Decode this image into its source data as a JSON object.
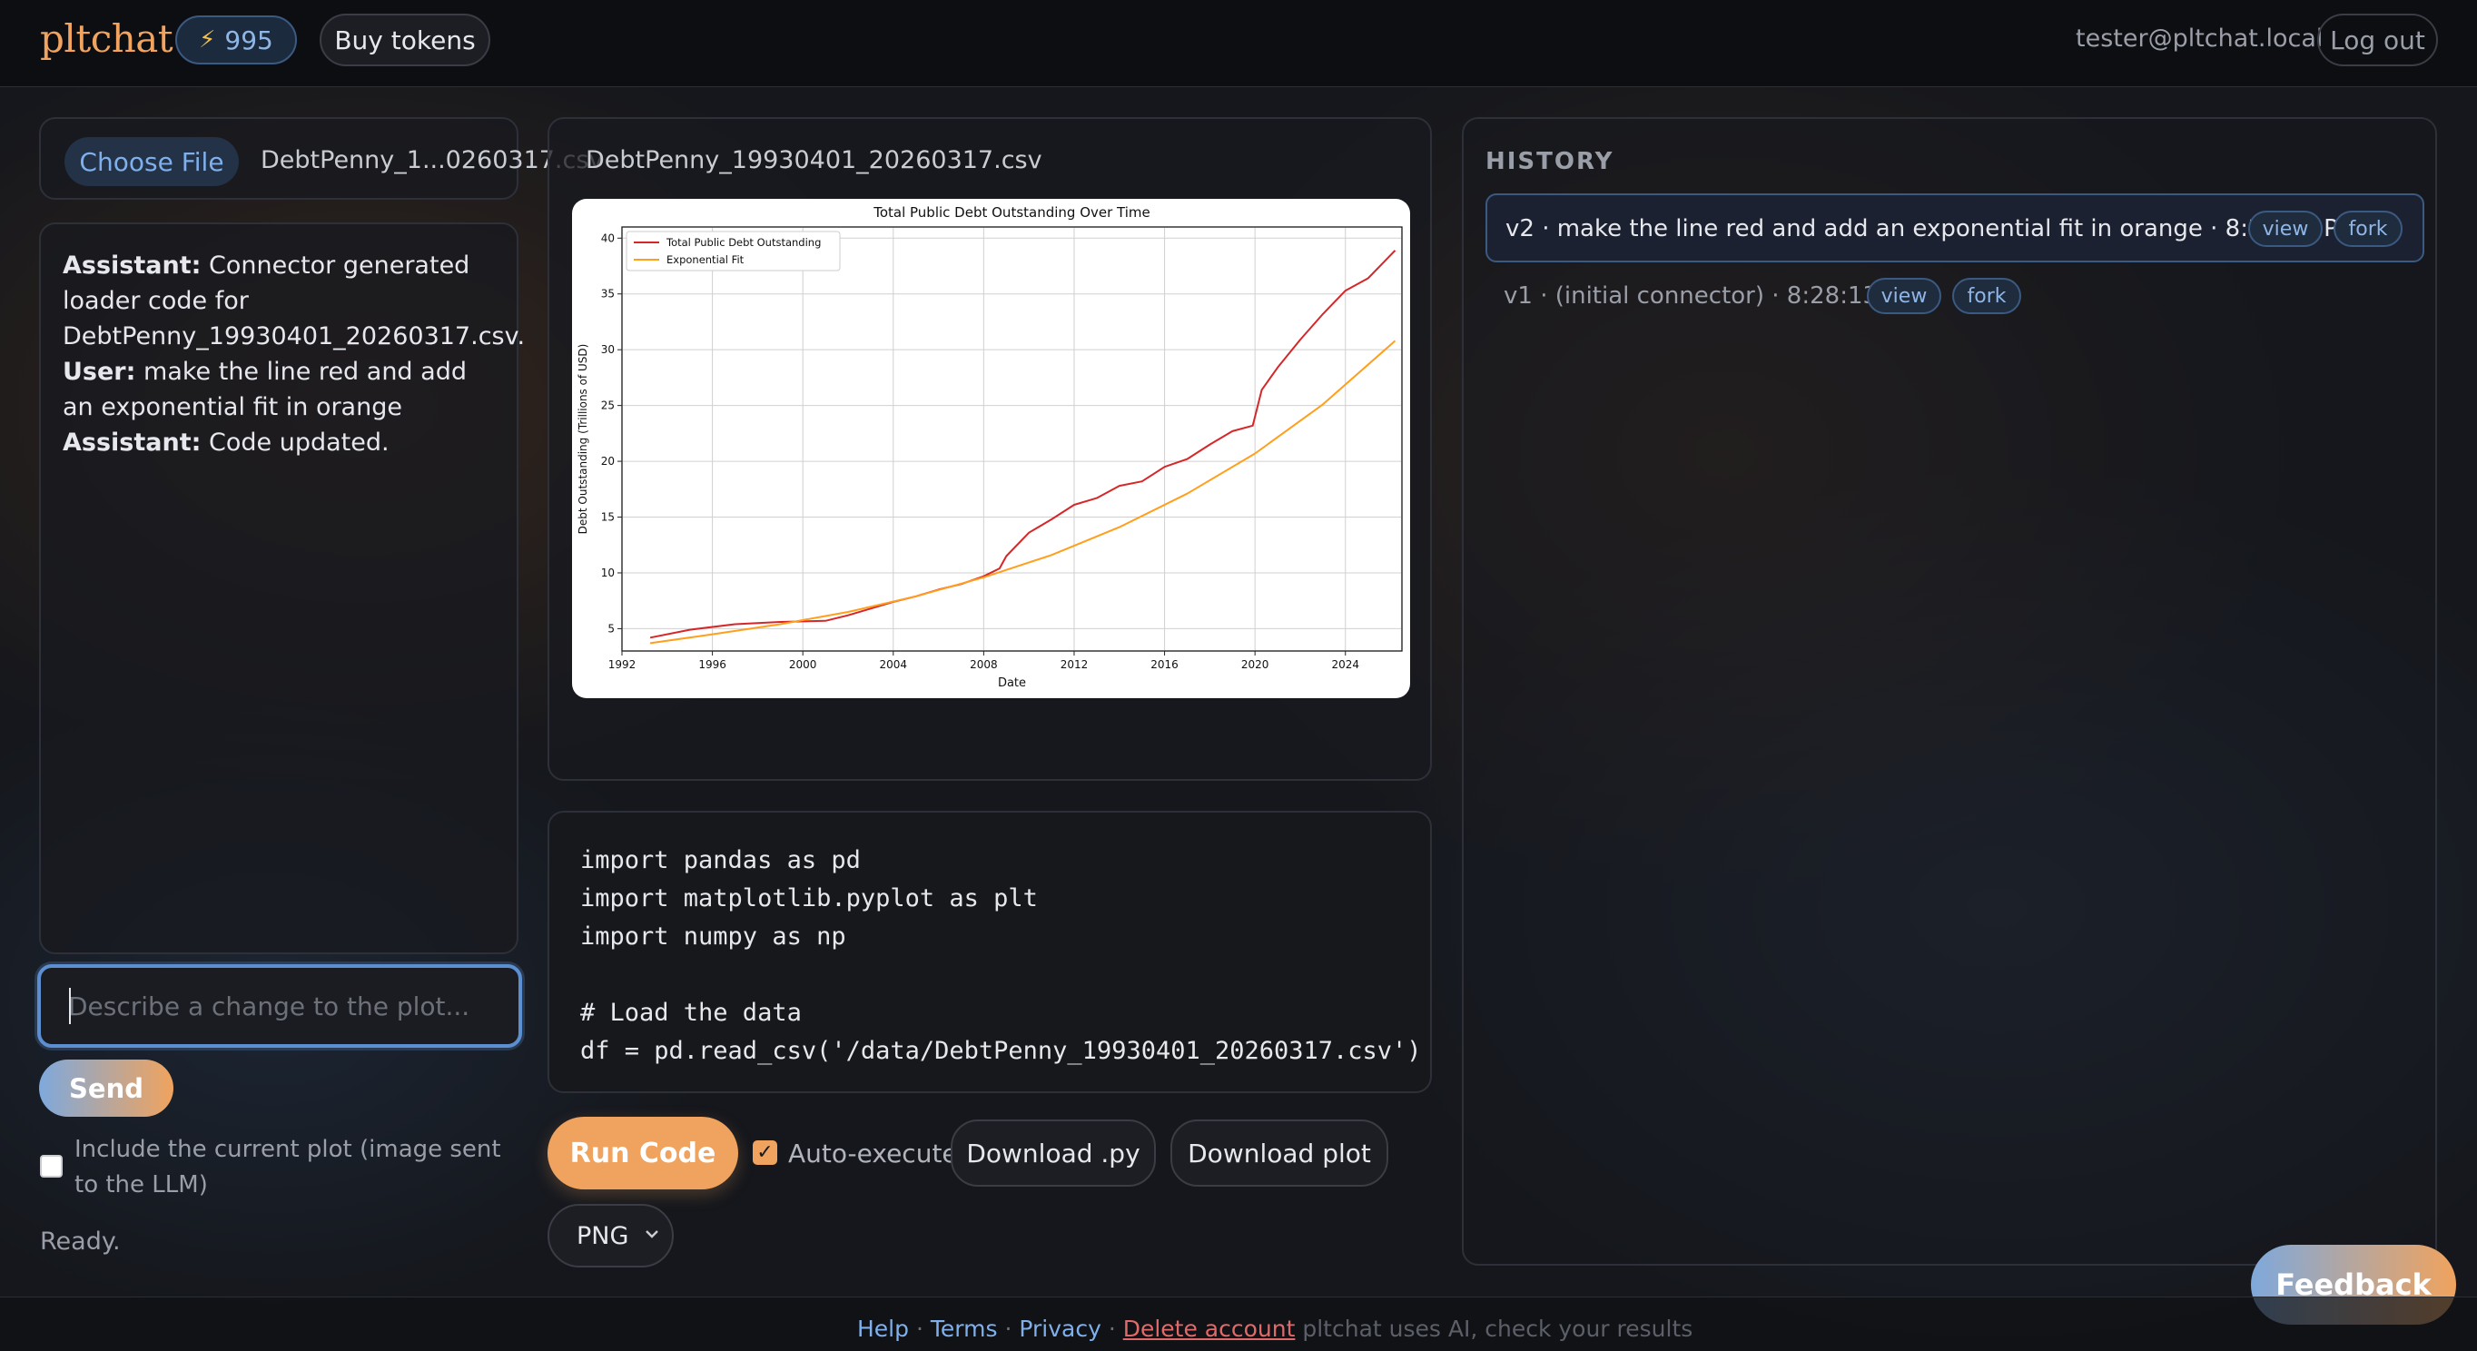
{
  "header": {
    "logo": "pltchat",
    "tokens": "995",
    "buy_tokens": "Buy tokens",
    "user_email": "tester@pltchat.local",
    "logout": "Log out"
  },
  "upload": {
    "choose_file": "Choose File",
    "file_name": "DebtPenny_1...0260317.csv"
  },
  "chat": {
    "messages": [
      {
        "role": "Assistant:",
        "text": "Connector generated loader code for DebtPenny_19930401_20260317.csv."
      },
      {
        "role": "User:",
        "text": "make the line red and add an exponential fit in orange"
      },
      {
        "role": "Assistant:",
        "text": "Code updated."
      }
    ],
    "input_placeholder": "Describe a change to the plot...",
    "send": "Send",
    "include_label": "Include the current plot (image sent to the LLM)",
    "status": "Ready."
  },
  "plot": {
    "filename": "DebtPenny_19930401_20260317.csv"
  },
  "chart_data": {
    "type": "line",
    "title": "Total Public Debt Outstanding Over Time",
    "xlabel": "Date",
    "ylabel": "Debt Outstanding (Trillions of USD)",
    "xlim": [
      1992,
      2026.5
    ],
    "ylim": [
      3,
      41
    ],
    "xticks": [
      "1992",
      "1996",
      "2000",
      "2004",
      "2008",
      "2012",
      "2016",
      "2020",
      "2024"
    ],
    "yticks": [
      "5",
      "10",
      "15",
      "20",
      "25",
      "30",
      "35",
      "40"
    ],
    "legend": "top-left",
    "grid": true,
    "series": [
      {
        "name": "Total Public Debt Outstanding",
        "color": "#d62728",
        "x": [
          1993.25,
          1995,
          1997,
          1999,
          2001,
          2002,
          2003,
          2004,
          2005,
          2006,
          2007,
          2008,
          2008.7,
          2009,
          2010,
          2011,
          2012,
          2013,
          2014,
          2015,
          2016,
          2017,
          2018,
          2019,
          2019.9,
          2020.3,
          2021,
          2022,
          2023,
          2024,
          2025,
          2026.2
        ],
        "y": [
          4.2,
          4.9,
          5.4,
          5.6,
          5.7,
          6.2,
          6.8,
          7.4,
          7.9,
          8.5,
          9.0,
          9.7,
          10.4,
          11.5,
          13.6,
          14.8,
          16.1,
          16.7,
          17.8,
          18.2,
          19.5,
          20.2,
          21.5,
          22.7,
          23.2,
          26.4,
          28.4,
          30.9,
          33.2,
          35.3,
          36.4,
          38.9
        ]
      },
      {
        "name": "Exponential Fit",
        "color": "#ff9f1c",
        "x": [
          1993.25,
          1996,
          1999,
          2002,
          2005,
          2008,
          2011,
          2014,
          2017,
          2020,
          2023,
          2026.2
        ],
        "y": [
          3.7,
          4.5,
          5.4,
          6.5,
          7.9,
          9.6,
          11.6,
          14.1,
          17.1,
          20.7,
          25.1,
          30.8
        ]
      }
    ]
  },
  "code": {
    "source": "import pandas as pd\nimport matplotlib.pyplot as plt\nimport numpy as np\n\n# Load the data\ndf = pd.read_csv('/data/DebtPenny_19930401_20260317.csv')"
  },
  "actions": {
    "run_code": "Run Code",
    "auto_execute": "Auto-execute",
    "download_py": "Download .py",
    "download_plot": "Download plot",
    "format": "PNG"
  },
  "history": {
    "title": "HISTORY",
    "items": [
      {
        "text": "v2 · make the line red and add an exponential fit in orange · 8:28:37 PM",
        "view": "view",
        "fork": "fork"
      },
      {
        "text": "v1 · (initial connector) · 8:28:13 PM",
        "view": "view",
        "fork": "fork"
      }
    ]
  },
  "feedback": "Feedback",
  "footer": {
    "help": "Help",
    "terms": "Terms",
    "privacy": "Privacy",
    "delete_account": "Delete account",
    "disclaimer": "pltchat uses AI, check your results"
  }
}
